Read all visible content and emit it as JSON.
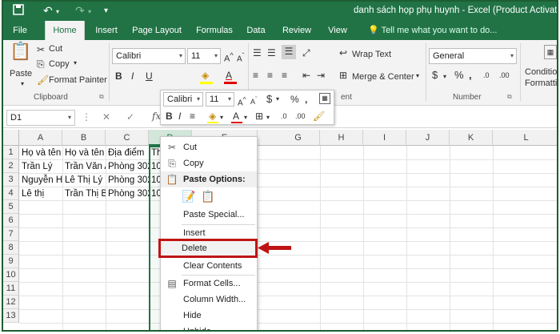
{
  "window": {
    "title": "danh sách họp phụ huynh - Excel (Product Activation Failed)"
  },
  "tabs": [
    "File",
    "Home",
    "Insert",
    "Page Layout",
    "Formulas",
    "Data",
    "Review",
    "View"
  ],
  "active_tab": "Home",
  "tell_me": "Tell me what you want to do...",
  "ribbon": {
    "paste_label": "Paste",
    "cut_label": "Cut",
    "copy_label": "Copy",
    "format_painter_label": "Format Painter",
    "clipboard_group": "Clipboard",
    "font_name": "Calibri",
    "font_size": "11",
    "wrap_text": "Wrap Text",
    "merge_center": "Merge & Center",
    "alignment_group_tail": "ent",
    "number_format": "General",
    "number_group": "Number",
    "conditional_formatting_line1": "Condition",
    "conditional_formatting_line2": "Formatting"
  },
  "mini_toolbar": {
    "font_name": "Calibri",
    "font_size": "11"
  },
  "formula_bar": {
    "name_box": "D1",
    "fx": "fx"
  },
  "columns": [
    "A",
    "B",
    "C",
    "D",
    "E",
    "F",
    "G",
    "H",
    "I",
    "J",
    "K",
    "L"
  ],
  "rows": [
    "1",
    "2",
    "3",
    "4",
    "5",
    "6",
    "7",
    "8",
    "9",
    "10",
    "11",
    "12",
    "13"
  ],
  "cells": [
    {
      "ref": "A1",
      "value": "Họ và tên"
    },
    {
      "ref": "B1",
      "value": "Họ và tên"
    },
    {
      "ref": "C1",
      "value": "Địa điểm"
    },
    {
      "ref": "D1",
      "value": "Th"
    },
    {
      "ref": "A2",
      "value": "Trần Lý"
    },
    {
      "ref": "B2",
      "value": "Trần Văn A"
    },
    {
      "ref": "C2",
      "value": "Phòng 302"
    },
    {
      "ref": "D2",
      "value": "10"
    },
    {
      "ref": "A3",
      "value": "Nguyễn H"
    },
    {
      "ref": "B3",
      "value": "Lê Thị Lý"
    },
    {
      "ref": "C3",
      "value": "Phòng 302"
    },
    {
      "ref": "D3",
      "value": "10"
    },
    {
      "ref": "A4",
      "value": "Lê thị"
    },
    {
      "ref": "B4",
      "value": "Trần Thị B"
    },
    {
      "ref": "C4",
      "value": "Phòng 302"
    },
    {
      "ref": "D4",
      "value": "10"
    }
  ],
  "context_menu": {
    "cut": "Cut",
    "copy": "Copy",
    "paste_options": "Paste Options:",
    "paste_special": "Paste Special...",
    "insert": "Insert",
    "delete": "Delete",
    "clear_contents": "Clear Contents",
    "format_cells": "Format Cells...",
    "column_width": "Column Width...",
    "hide": "Hide",
    "unhide": "Unhide"
  },
  "colors": {
    "excel_green": "#217346",
    "highlight_red": "#c01414",
    "selected_column_border": "#217346"
  }
}
